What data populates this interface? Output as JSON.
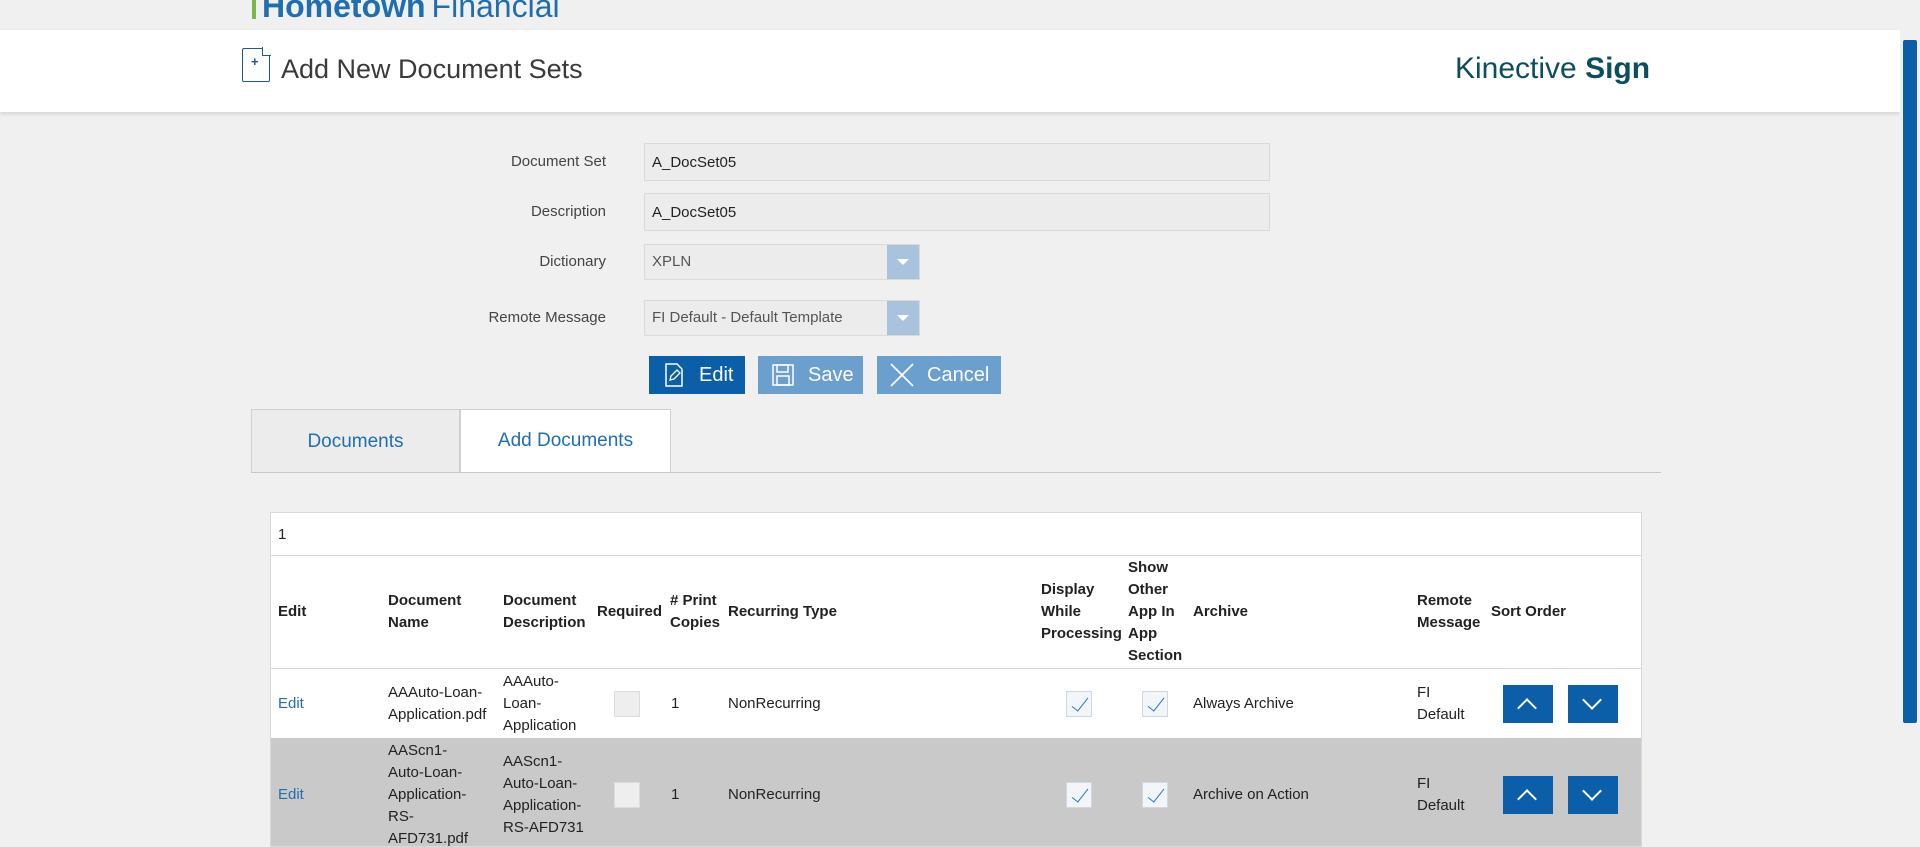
{
  "brand": {
    "name_bold": "Hometown",
    "name_light": "Financial"
  },
  "header": {
    "title": "Add New Document Sets",
    "product_light": "Kinective",
    "product_bold": "Sign"
  },
  "form": {
    "document_set": {
      "label": "Document Set",
      "value": "A_DocSet05"
    },
    "description": {
      "label": "Description",
      "value": "A_DocSet05"
    },
    "dictionary": {
      "label": "Dictionary",
      "value": "XPLN"
    },
    "remote_message": {
      "label": "Remote Message",
      "value": "FI Default - Default Template"
    }
  },
  "buttons": {
    "edit": "Edit",
    "save": "Save",
    "cancel": "Cancel"
  },
  "tabs": {
    "documents": "Documents",
    "add_documents": "Add Documents"
  },
  "table": {
    "page": "1",
    "headers": {
      "edit": "Edit",
      "document_name": "Document Name",
      "document_description": "Document Description",
      "required": "Required",
      "print_copies": "# Print Copies",
      "recurring_type": "Recurring Type",
      "display_while_processing": "Display While Processing",
      "show_other_app": "Show Other App In App Section",
      "archive": "Archive",
      "remote_message": "Remote Message",
      "sort_order": "Sort Order"
    },
    "rows": [
      {
        "edit": "Edit",
        "document_name": "AAAuto-Loan-Application.pdf",
        "document_description": "AAAuto-Loan-Application",
        "required": false,
        "print_copies": "1",
        "recurring_type": "NonRecurring",
        "display_while_processing": true,
        "show_other_app": true,
        "archive": "Always Archive",
        "remote_message": "FI Default"
      },
      {
        "edit": "Edit",
        "document_name": "AAScn1-Auto-Loan-Application-RS-AFD731.pdf",
        "document_description": "AAScn1-Auto-Loan-Application-RS-AFD731",
        "required": false,
        "print_copies": "1",
        "recurring_type": "NonRecurring",
        "display_while_processing": true,
        "show_other_app": true,
        "archive": "Archive on Action",
        "remote_message": "FI Default"
      }
    ]
  },
  "colors": {
    "primary": "#0b5fa8",
    "primary_light": "#6a9fce",
    "link": "#1f6fb0",
    "brand_green": "#7ab648"
  }
}
